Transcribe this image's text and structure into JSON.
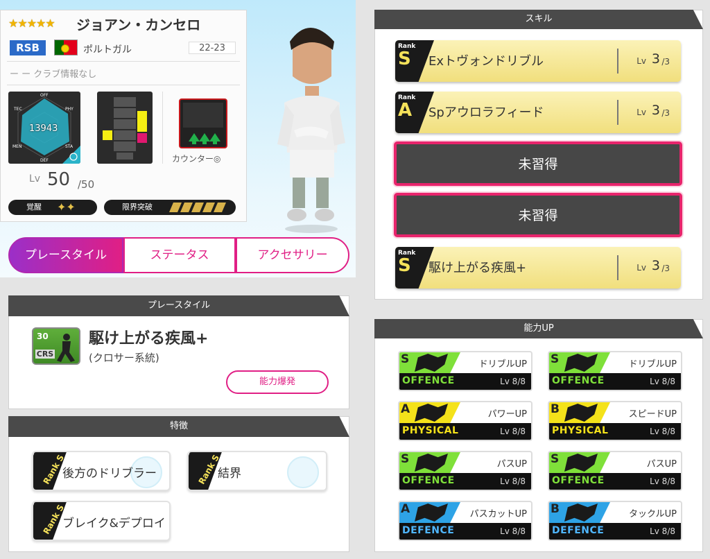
{
  "player": {
    "stars": "★★★★★",
    "name": "ジョアン・カンセロ",
    "position": "RSB",
    "country": "ポルトガル",
    "season": "22-23",
    "club": "ー ー クラブ情報なし",
    "total": "13943",
    "radar_labels": [
      "OFF",
      "TEC",
      "PHY",
      "MEN",
      "STA",
      "DEF"
    ],
    "counter": "カウンター◎",
    "lv_label": "Lv",
    "lv": "50",
    "lv_max": "/50",
    "awaken": "覚醒",
    "awaken_stars": "✦✦",
    "limit": "限界突破"
  },
  "tabs": [
    "プレースタイル",
    "ステータス",
    "アクセサリー"
  ],
  "playstyle": {
    "header": "プレースタイル",
    "num": "30",
    "code": "CRS",
    "name": "駆け上がる疾風+",
    "sub": "(クロサー系統)",
    "button": "能力爆発"
  },
  "traits": {
    "header": "特徴",
    "rank": "Rank S",
    "items": [
      "後方のドリブラー",
      "結界",
      "ブレイク&デプロイ"
    ]
  },
  "skills": {
    "header": "スキル",
    "rank_label": "Rank",
    "lv_label": "Lv",
    "items": [
      {
        "rank": "S",
        "name": "Exトヴォンドリブル",
        "lv": "3",
        "max": "/3"
      },
      {
        "rank": "A",
        "name": "Spアウロラフィード",
        "lv": "3",
        "max": "/3"
      },
      {
        "name": "未習得"
      },
      {
        "name": "未習得"
      },
      {
        "rank": "S",
        "name": "駆け上がる疾風+",
        "lv": "3",
        "max": "/3"
      }
    ]
  },
  "abilities": {
    "header": "能力UP",
    "items": [
      {
        "grade": "S",
        "label": "ドリブルUP",
        "cat": "OFFENCE",
        "lv": "Lv 8/8",
        "color": "#7fe03a",
        "text": "#7fe03a"
      },
      {
        "grade": "S",
        "label": "ドリブルUP",
        "cat": "OFFENCE",
        "lv": "Lv 8/8",
        "color": "#7fe03a",
        "text": "#7fe03a"
      },
      {
        "grade": "A",
        "label": "パワーUP",
        "cat": "PHYSICAL",
        "lv": "Lv 8/8",
        "color": "#f4e21a",
        "text": "#f4e21a"
      },
      {
        "grade": "B",
        "label": "スピードUP",
        "cat": "PHYSICAL",
        "lv": "Lv 8/8",
        "color": "#f4e21a",
        "text": "#f4e21a"
      },
      {
        "grade": "S",
        "label": "パスUP",
        "cat": "OFFENCE",
        "lv": "Lv 8/8",
        "color": "#7fe03a",
        "text": "#7fe03a"
      },
      {
        "grade": "S",
        "label": "パスUP",
        "cat": "OFFENCE",
        "lv": "Lv 8/8",
        "color": "#7fe03a",
        "text": "#7fe03a"
      },
      {
        "grade": "A",
        "label": "パスカットUP",
        "cat": "DEFENCE",
        "lv": "Lv 8/8",
        "color": "#2ea3e6",
        "text": "#4fb6ff"
      },
      {
        "grade": "B",
        "label": "タックルUP",
        "cat": "DEFENCE",
        "lv": "Lv 8/8",
        "color": "#2ea3e6",
        "text": "#4fb6ff"
      }
    ]
  },
  "colors": {
    "accent": "#e01f85",
    "purple": "#9b2fc8",
    "panel_header": "#4a4a4a",
    "skill_yellow": "#f1df7d",
    "unlearned_border": "#e8246c"
  }
}
